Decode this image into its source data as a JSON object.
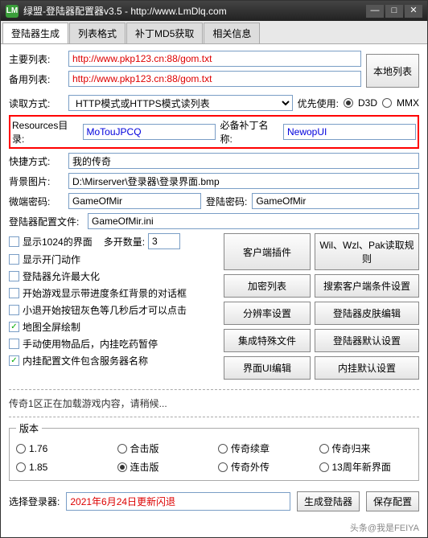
{
  "titlebar": {
    "title": "绿盟-登陆器配置器v3.5 - http://www.LmDlq.com",
    "icon_text": "LM"
  },
  "tabs": [
    "登陆器生成",
    "列表格式",
    "补丁MD5获取",
    "相关信息"
  ],
  "form": {
    "main_list_label": "主要列表:",
    "main_list_value": "http://www.pkp123.cn:88/gom.txt",
    "backup_list_label": "备用列表:",
    "backup_list_value": "http://www.pkp123.cn:88/gom.txt",
    "local_list_btn": "本地列表",
    "read_mode_label": "读取方式:",
    "read_mode_value": "HTTP模式或HTTPS模式读列表",
    "prefer_label": "优先使用:",
    "d3d": "D3D",
    "mmx": "MMX",
    "resources_label": "Resources目录:",
    "resources_value": "MoTouJPCQ",
    "patch_label": "必备补丁名称:",
    "patch_value": "NewopUI",
    "shortcut_label": "快捷方式:",
    "shortcut_value": "我的传奇",
    "bg_label": "背景图片:",
    "bg_value": "D:\\Mirserver\\登录器\\登录界面.bmp",
    "micro_pwd_label": "微端密码:",
    "micro_pwd_value": "GameOfMir",
    "login_pwd_label": "登陆密码:",
    "login_pwd_value": "GameOfMir",
    "config_label": "登陆器配置文件:",
    "config_value": "GameOfMir.ini",
    "multi_open_label": "多开数量:",
    "multi_open_value": "3"
  },
  "checkboxes": {
    "c1": "显示1024的界面",
    "c2": "显示开门动作",
    "c3": "登陆器允许最大化",
    "c4": "开始游戏显示带进度条红背景的对话框",
    "c5": "小退开始按钮灰色等几秒后才可以点击",
    "c6": "地图全屏绘制",
    "c7": "手动使用物品后，内挂吃药暂停",
    "c8": "内挂配置文件包含服务器名称"
  },
  "buttons": {
    "b1": "客户端插件",
    "b2": "Wil、Wzl、Pak读取规则",
    "b3": "加密列表",
    "b4": "搜索客户端条件设置",
    "b5": "分辨率设置",
    "b6": "登陆器皮肤编辑",
    "b7": "集成特殊文件",
    "b8": "登陆器默认设置",
    "b9": "界面UI编辑",
    "b10": "内挂默认设置"
  },
  "status_text": "传奇1区正在加载游戏内容，请稍候...",
  "version": {
    "legend": "版本",
    "r1": "1.76",
    "r2": "合击版",
    "r3": "传奇续章",
    "r4": "传奇归来",
    "r5": "1.85",
    "r6": "连击版",
    "r7": "传奇外传",
    "r8": "13周年新界面"
  },
  "footer": {
    "select_label": "选择登录器:",
    "date_text": "2021年6月24日更新闪退",
    "gen_btn": "生成登陆器",
    "save_btn": "保存配置"
  },
  "watermark": "头条@我是FEIYA"
}
